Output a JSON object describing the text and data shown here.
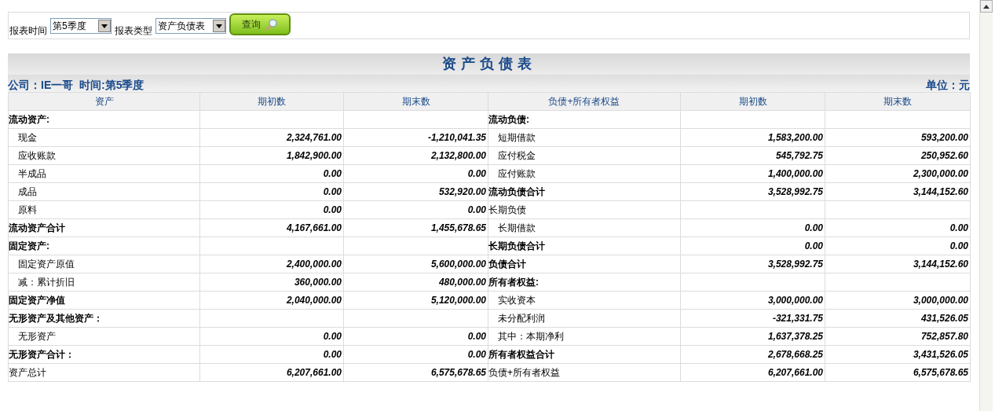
{
  "query_form": {
    "period_label": "报表时间",
    "period_value": "第5季度",
    "type_label": "报表类型",
    "type_value": "资产负债表",
    "query_button": "查询"
  },
  "report": {
    "title": "资产负债表",
    "company": "公司：IE一哥  时间:第5季度",
    "unit": "单位：元",
    "columns": [
      "资产",
      "期初数",
      "期末数",
      "负债+所有者权益",
      "期初数",
      "期末数"
    ],
    "rows": [
      {
        "left": {
          "label": "流动资产:",
          "kind": "heading"
        },
        "left_begin": "",
        "left_end": "",
        "right": {
          "label": "流动负债:",
          "kind": "heading"
        },
        "right_begin": "",
        "right_end": ""
      },
      {
        "left": {
          "label": "现金",
          "kind": "item"
        },
        "left_begin": "2,324,761.00",
        "left_end": "-1,210,041.35",
        "right": {
          "label": "短期借款",
          "kind": "item"
        },
        "right_begin": "1,583,200.00",
        "right_end": "593,200.00"
      },
      {
        "left": {
          "label": "应收账款",
          "kind": "item"
        },
        "left_begin": "1,842,900.00",
        "left_end": "2,132,800.00",
        "right": {
          "label": "应付税金",
          "kind": "item"
        },
        "right_begin": "545,792.75",
        "right_end": "250,952.60"
      },
      {
        "left": {
          "label": "半成品",
          "kind": "item"
        },
        "left_begin": "0.00",
        "left_end": "0.00",
        "right": {
          "label": "应付账款",
          "kind": "item"
        },
        "right_begin": "1,400,000.00",
        "right_end": "2,300,000.00"
      },
      {
        "left": {
          "label": "成品",
          "kind": "item"
        },
        "left_begin": "0.00",
        "left_end": "532,920.00",
        "right": {
          "label": "流动负债合计",
          "kind": "heading"
        },
        "right_begin": "3,528,992.75",
        "right_end": "3,144,152.60"
      },
      {
        "left": {
          "label": "原料",
          "kind": "item"
        },
        "left_begin": "0.00",
        "left_end": "0.00",
        "right": {
          "label": "长期负债",
          "kind": "plain"
        },
        "right_begin": "",
        "right_end": ""
      },
      {
        "left": {
          "label": "流动资产合计",
          "kind": "heading"
        },
        "left_begin": "4,167,661.00",
        "left_end": "1,455,678.65",
        "right": {
          "label": "长期借款",
          "kind": "item"
        },
        "right_begin": "0.00",
        "right_end": "0.00"
      },
      {
        "left": {
          "label": "固定资产:",
          "kind": "heading"
        },
        "left_begin": "",
        "left_end": "",
        "right": {
          "label": "长期负债合计",
          "kind": "heading"
        },
        "right_begin": "0.00",
        "right_end": "0.00"
      },
      {
        "left": {
          "label": "固定资产原值",
          "kind": "item"
        },
        "left_begin": "2,400,000.00",
        "left_end": "5,600,000.00",
        "right": {
          "label": "负债合计",
          "kind": "heading"
        },
        "right_begin": "3,528,992.75",
        "right_end": "3,144,152.60"
      },
      {
        "left": {
          "label": "减：累计折旧",
          "kind": "item"
        },
        "left_begin": "360,000.00",
        "left_end": "480,000.00",
        "right": {
          "label": "所有者权益:",
          "kind": "heading"
        },
        "right_begin": "",
        "right_end": ""
      },
      {
        "left": {
          "label": "固定资产净值",
          "kind": "heading"
        },
        "left_begin": "2,040,000.00",
        "left_end": "5,120,000.00",
        "right": {
          "label": "实收资本",
          "kind": "item"
        },
        "right_begin": "3,000,000.00",
        "right_end": "3,000,000.00"
      },
      {
        "left": {
          "label": "无形资产及其他资产：",
          "kind": "heading"
        },
        "left_begin": "",
        "left_end": "",
        "right": {
          "label": "未分配利润",
          "kind": "item"
        },
        "right_begin": "-321,331.75",
        "right_end": "431,526.05"
      },
      {
        "left": {
          "label": "无形资产",
          "kind": "item"
        },
        "left_begin": "0.00",
        "left_end": "0.00",
        "right": {
          "label": "其中：本期净利",
          "kind": "item"
        },
        "right_begin": "1,637,378.25",
        "right_end": "752,857.80"
      },
      {
        "left": {
          "label": "无形资产合计：",
          "kind": "heading"
        },
        "left_begin": "0.00",
        "left_end": "0.00",
        "right": {
          "label": "所有者权益合计",
          "kind": "heading"
        },
        "right_begin": "2,678,668.25",
        "right_end": "3,431,526.05"
      },
      {
        "left": {
          "label": "资产总计",
          "kind": "plain"
        },
        "left_begin": "6,207,661.00",
        "left_end": "6,575,678.65",
        "right": {
          "label": "负债+所有者权益",
          "kind": "plain"
        },
        "right_begin": "6,207,661.00",
        "right_end": "6,575,678.65"
      }
    ]
  }
}
